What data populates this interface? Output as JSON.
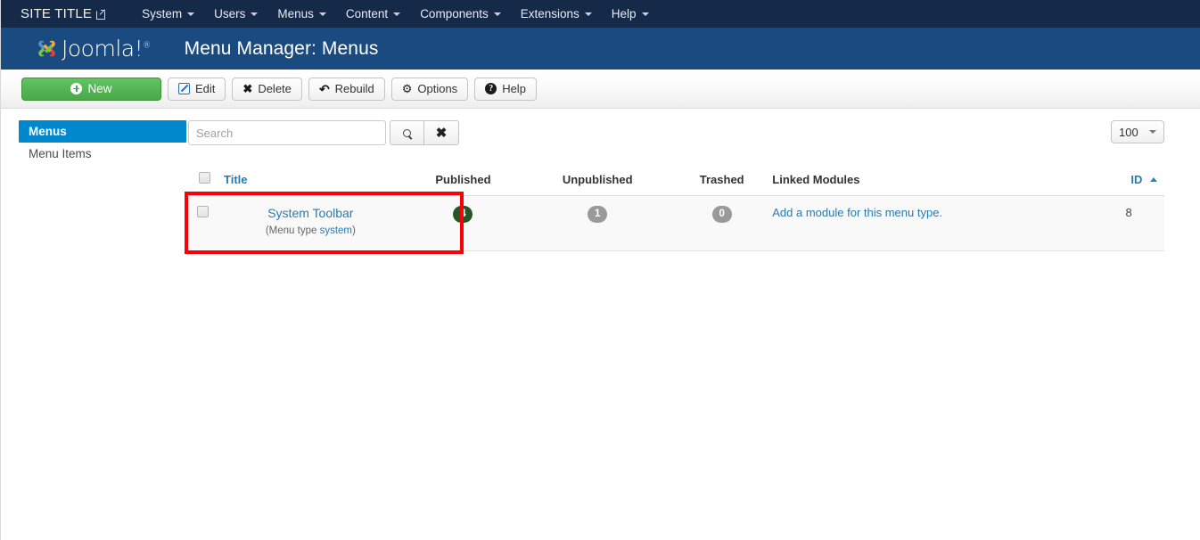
{
  "topnav": {
    "site_title": "SITE TITLE",
    "site_title_icon": "external-link-icon",
    "items": [
      {
        "label": "System"
      },
      {
        "label": "Users"
      },
      {
        "label": "Menus"
      },
      {
        "label": "Content"
      },
      {
        "label": "Components"
      },
      {
        "label": "Extensions"
      },
      {
        "label": "Help"
      }
    ]
  },
  "subheader": {
    "logo_text": "Joomla!",
    "logo_sup": "®",
    "page_title": "Menu Manager: Menus"
  },
  "toolbar": {
    "new_label": "New",
    "edit_label": "Edit",
    "delete_label": "Delete",
    "rebuild_label": "Rebuild",
    "options_label": "Options",
    "help_label": "Help"
  },
  "sidebar": {
    "items": [
      {
        "label": "Menus",
        "active": true
      },
      {
        "label": "Menu Items",
        "active": false
      }
    ]
  },
  "filter": {
    "search_placeholder": "Search",
    "search_value": "",
    "search_button_icon": "search-icon",
    "clear_button_icon": "clear-icon",
    "limit_value": "100"
  },
  "table": {
    "headers": {
      "title": "Title",
      "published": "Published",
      "unpublished": "Unpublished",
      "trashed": "Trashed",
      "linked_modules": "Linked Modules",
      "id": "ID"
    },
    "sort_column": "ID",
    "sort_direction": "asc",
    "rows": [
      {
        "title": "System Toolbar",
        "subtitle_prefix": "(Menu type ",
        "menu_type": "system",
        "subtitle_suffix": ")",
        "published": "4",
        "unpublished": "1",
        "trashed": "0",
        "linked_modules": "Add a module for this menu type.",
        "id": "8"
      }
    ]
  },
  "annotation": {
    "color": "#fb0007",
    "target": "System Toolbar row title cell"
  },
  "colors": {
    "topbar": "#152a48",
    "subheader": "#1a4b80",
    "sidebar_active": "#0088cc",
    "new_button": "#49a849",
    "link": "#2a7ab0",
    "badge_published": "#255625",
    "badge_gray": "#999999",
    "annotation": "#fb0007"
  }
}
